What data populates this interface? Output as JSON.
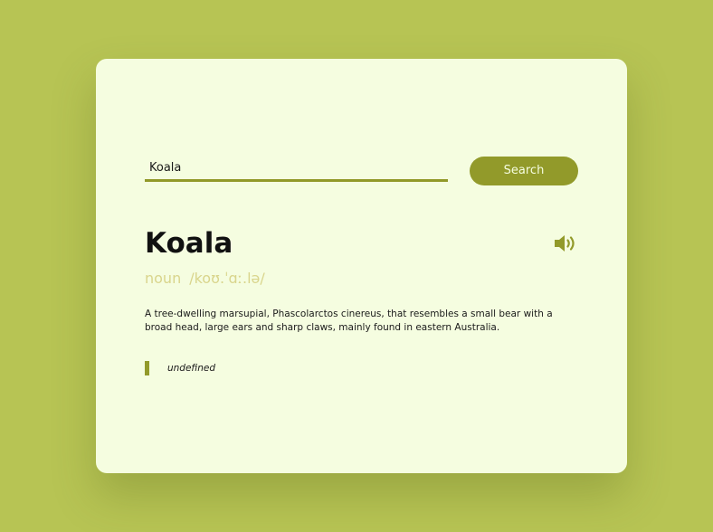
{
  "search": {
    "value": "Koala",
    "button_label": "Search"
  },
  "entry": {
    "word": "Koala",
    "part_of_speech": "noun",
    "phonetic": "/koʊ.ˈɑː.lə/",
    "definition": "A tree-dwelling marsupial, Phascolarctos cinereus, that resembles a small bear with a broad head, large ears and sharp claws, mainly found in eastern Australia.",
    "example": "undefined"
  },
  "icons": {
    "audio": "speaker-icon"
  },
  "colors": {
    "page_background": "#b7c454",
    "card_background": "#f5fde0",
    "accent": "#929a2a",
    "muted_text": "#d9d58c"
  }
}
